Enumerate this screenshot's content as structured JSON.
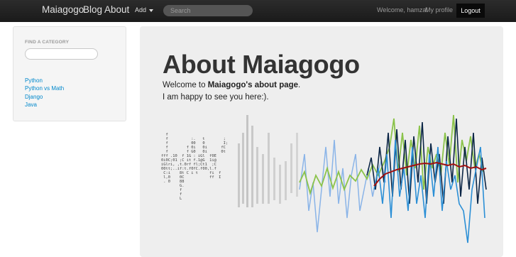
{
  "navbar": {
    "brand": "Maiagogo",
    "links": {
      "blog": "Blog",
      "about": "About"
    },
    "add_label": "Add",
    "search_placeholder": "Search",
    "welcome_text": "Welcome, hamza!",
    "profile_label": "My profile",
    "logout_label": "Logout"
  },
  "sidebar": {
    "heading": "FIND A CATEGORY",
    "categories": [
      "Python",
      "Python vs Math",
      "Django",
      "Java"
    ]
  },
  "hero": {
    "title": "About Maiagogo",
    "intro_prefix": "Welcome to ",
    "intro_bold": "Maiagogo's about page",
    "intro_suffix": ".",
    "line2": "I am happy to see you here:)."
  },
  "colors": {
    "link": "#0088cc",
    "navbar": "#1f1f1f",
    "hero_bg": "#eeeeee",
    "series_light_blue": "#8ab4e8",
    "series_green": "#8bc34a",
    "series_dark": "#0b2545",
    "series_blue": "#2b8fd6",
    "series_red": "#a01010"
  }
}
